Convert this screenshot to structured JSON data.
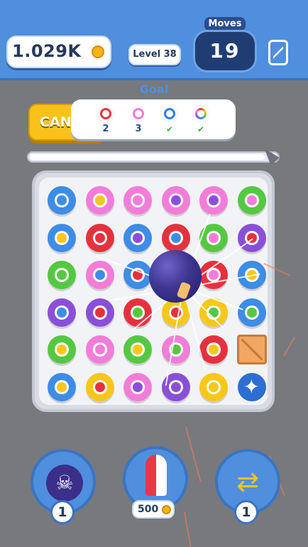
{
  "header": {
    "coins_text": "1.029K",
    "coin_icon": "coin-icon",
    "level_label": "Level 38",
    "moves_label": "Moves",
    "moves_value": "19",
    "phone_icon": "phone-shake-icon"
  },
  "goal": {
    "title": "Goal",
    "items": [
      {
        "color": "#e8323f",
        "hole": "#ffffff",
        "count": "2",
        "done": false
      },
      {
        "color": "#f07bd9",
        "hole": "#ffffff",
        "count": "3",
        "done": false
      },
      {
        "color": "#2e7de0",
        "hole": "#ffffff",
        "count": "✔",
        "done": true
      },
      {
        "color": "rainbow",
        "hole": "#ffffff",
        "count": "✔",
        "done": true
      }
    ]
  },
  "cancel_button": "CANCEL",
  "progress": 0.95,
  "board": {
    "colors": {
      "B": "#3d8ce6",
      "P": "#f27dd8",
      "R": "#e5313e",
      "G": "#55c842",
      "Y": "#f7c71a",
      "V": "#8a4fd8"
    },
    "rows": [
      [
        [
          "B",
          "B"
        ],
        [
          "P",
          "Y"
        ],
        [
          "P",
          "P"
        ],
        [
          "P",
          "V"
        ],
        [
          "P",
          "V"
        ],
        [
          "G",
          "P"
        ]
      ],
      [
        [
          "B",
          "Y"
        ],
        [
          "R",
          "R"
        ],
        [
          "B",
          "V"
        ],
        [
          "R",
          "B"
        ],
        [
          "G",
          "P"
        ],
        [
          "V",
          "R"
        ]
      ],
      [
        [
          "G",
          "G"
        ],
        [
          "P",
          "B"
        ],
        [
          "B",
          "R"
        ],
        [
          "X",
          "X"
        ],
        [
          "R",
          "P"
        ],
        [
          "B",
          "Y"
        ]
      ],
      [
        [
          "V",
          "B"
        ],
        [
          "V",
          "R"
        ],
        [
          "R",
          "G"
        ],
        [
          "Y",
          "R"
        ],
        [
          "Y",
          "G"
        ],
        [
          "B",
          "G"
        ]
      ],
      [
        [
          "G",
          "Y"
        ],
        [
          "P",
          "P"
        ],
        [
          "G",
          "Y"
        ],
        [
          "P",
          "G"
        ],
        [
          "R",
          "Y"
        ],
        [
          "CRATE",
          "CRATE"
        ]
      ],
      [
        [
          "B",
          "Y"
        ],
        [
          "Y",
          "R"
        ],
        [
          "P",
          "V"
        ],
        [
          "V",
          "V"
        ],
        [
          "Y",
          "Y"
        ],
        [
          "SHURIKEN",
          "SHURIKEN"
        ]
      ]
    ]
  },
  "boosters": [
    {
      "name": "bomb-booster",
      "icon": "skull-bomb-icon",
      "badge": "1",
      "glyph": "☠"
    },
    {
      "name": "rocket-booster",
      "icon": "rocket-icon",
      "price": "500"
    },
    {
      "name": "swap-booster",
      "icon": "swap-arrows-icon",
      "badge": "1",
      "glyph": "⇄"
    }
  ]
}
